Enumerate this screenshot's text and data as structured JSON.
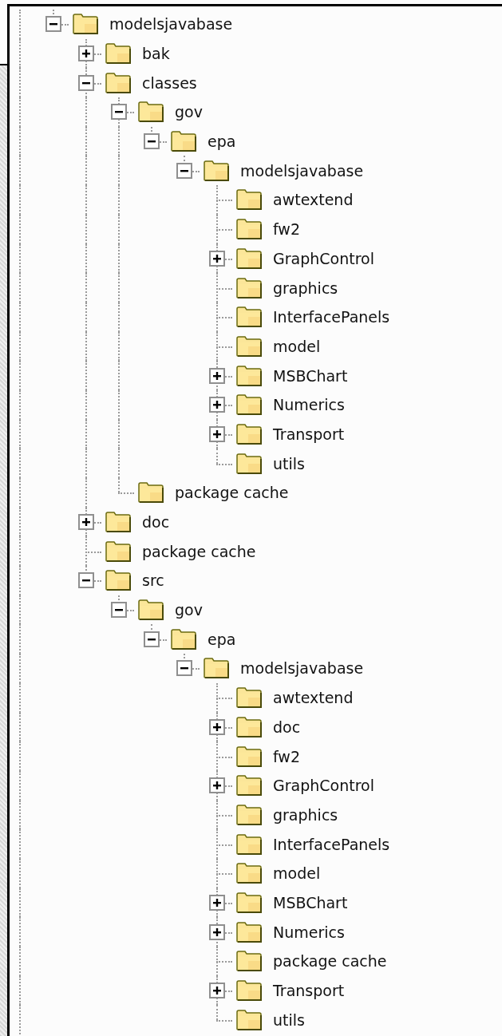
{
  "tree": [
    {
      "label": "modelsjavabase",
      "expandable": true,
      "expanded": true,
      "children": [
        {
          "label": "bak",
          "expandable": true,
          "expanded": false
        },
        {
          "label": "classes",
          "expandable": true,
          "expanded": true,
          "children": [
            {
              "label": "gov",
              "expandable": true,
              "expanded": true,
              "children": [
                {
                  "label": "epa",
                  "expandable": true,
                  "expanded": true,
                  "children": [
                    {
                      "label": "modelsjavabase",
                      "expandable": true,
                      "expanded": true,
                      "children": [
                        {
                          "label": "awtextend",
                          "expandable": false
                        },
                        {
                          "label": "fw2",
                          "expandable": false
                        },
                        {
                          "label": "GraphControl",
                          "expandable": true,
                          "expanded": false
                        },
                        {
                          "label": "graphics",
                          "expandable": false
                        },
                        {
                          "label": "InterfacePanels",
                          "expandable": false
                        },
                        {
                          "label": "model",
                          "expandable": false
                        },
                        {
                          "label": "MSBChart",
                          "expandable": true,
                          "expanded": false
                        },
                        {
                          "label": "Numerics",
                          "expandable": true,
                          "expanded": false
                        },
                        {
                          "label": "Transport",
                          "expandable": true,
                          "expanded": false
                        },
                        {
                          "label": "utils",
                          "expandable": false
                        }
                      ]
                    }
                  ]
                }
              ]
            },
            {
              "label": "package cache",
              "expandable": false
            }
          ]
        },
        {
          "label": "doc",
          "expandable": true,
          "expanded": false
        },
        {
          "label": "package cache",
          "expandable": false
        },
        {
          "label": "src",
          "expandable": true,
          "expanded": true,
          "children": [
            {
              "label": "gov",
              "expandable": true,
              "expanded": true,
              "children": [
                {
                  "label": "epa",
                  "expandable": true,
                  "expanded": true,
                  "children": [
                    {
                      "label": "modelsjavabase",
                      "expandable": true,
                      "expanded": true,
                      "children": [
                        {
                          "label": "awtextend",
                          "expandable": false
                        },
                        {
                          "label": "doc",
                          "expandable": true,
                          "expanded": false
                        },
                        {
                          "label": "fw2",
                          "expandable": false
                        },
                        {
                          "label": "GraphControl",
                          "expandable": true,
                          "expanded": false
                        },
                        {
                          "label": "graphics",
                          "expandable": false
                        },
                        {
                          "label": "InterfacePanels",
                          "expandable": false
                        },
                        {
                          "label": "model",
                          "expandable": false
                        },
                        {
                          "label": "MSBChart",
                          "expandable": true,
                          "expanded": false
                        },
                        {
                          "label": "Numerics",
                          "expandable": true,
                          "expanded": false
                        },
                        {
                          "label": "package cache",
                          "expandable": false
                        },
                        {
                          "label": "Transport",
                          "expandable": true,
                          "expanded": false
                        },
                        {
                          "label": "utils",
                          "expandable": false
                        }
                      ]
                    }
                  ]
                }
              ]
            }
          ]
        }
      ]
    }
  ]
}
